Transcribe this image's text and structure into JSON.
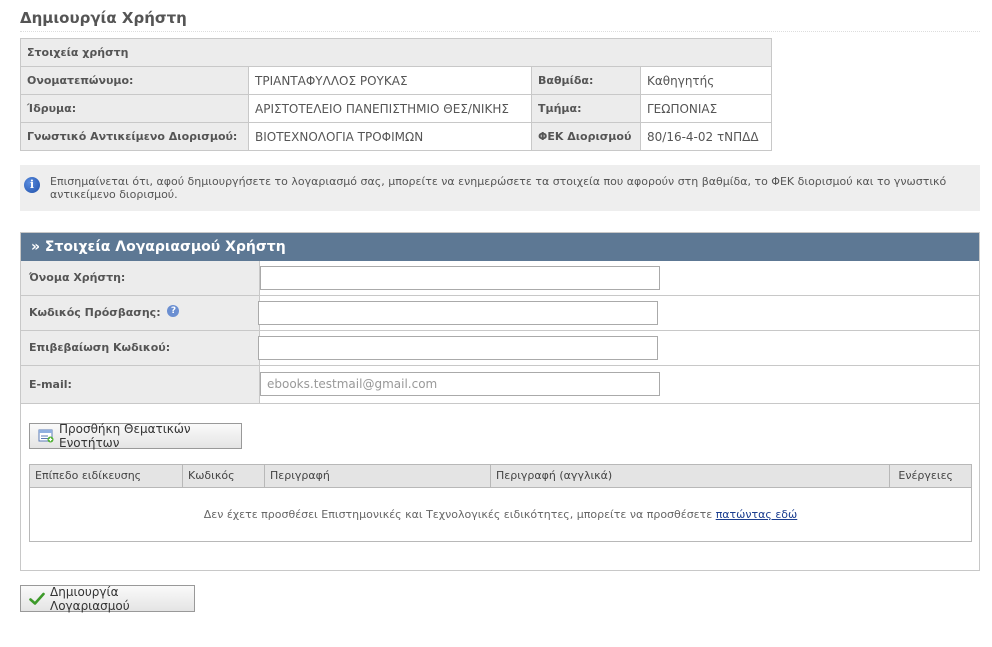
{
  "page": {
    "title": "Δημιουργία Χρήστη"
  },
  "user_info": {
    "heading": "Στοιχεία χρήστη",
    "rows": [
      {
        "label": "Ονοματεπώνυμο:",
        "value": "ΤΡΙΑΝΤΑΦΥΛΛΟΣ ΡΟΥΚΑΣ",
        "label2": "Βαθμίδα:",
        "value2": "Καθηγητής"
      },
      {
        "label": "Ίδρυμα:",
        "value": "ΑΡΙΣΤΟΤΕΛΕΙΟ ΠΑΝΕΠΙΣΤΗΜΙΟ ΘΕΣ/ΝΙΚΗΣ",
        "label2": "Τμήμα:",
        "value2": "ΓΕΩΠΟΝΙΑΣ"
      },
      {
        "label": "Γνωστικό Αντικείμενο Διορισμού:",
        "value": "ΒΙΟΤΕΧΝΟΛΟΓΙΑ ΤΡΟΦΙΜΩΝ",
        "label2": "ΦΕΚ Διορισμού",
        "value2": "80/16-4-02 τΝΠΔΔ"
      }
    ]
  },
  "notice": {
    "icon": "info-icon",
    "text": "Επισημαίνεται ότι, αφού δημιουργήσετε το λογαριασμό σας, μπορείτε να ενημερώσετε τα στοιχεία που αφορούν στη βαθμίδα, το ΦΕΚ διορισμού και το γνωστικό αντικείμενο διορισμού."
  },
  "account": {
    "header": "» Στοιχεία Λογαριασμού Χρήστη",
    "username_label": "Όνομα Χρήστη:",
    "username_value": "",
    "password_label": "Κωδικός Πρόσβασης:",
    "password_value": "",
    "confirm_label": "Επιβεβαίωση Κωδικού:",
    "confirm_value": "",
    "email_label": "E-mail:",
    "email_placeholder": "ebooks.testmail@gmail.com",
    "help_icon": "question-icon"
  },
  "subjects": {
    "add_button": "Προσθήκη Θεματικών Ενοτήτων",
    "columns": [
      "Επίπεδο ειδίκευσης",
      "Κωδικός",
      "Περιγραφή",
      "Περιγραφή (αγγλικά)",
      "Ενέργειες"
    ],
    "empty_text": "Δεν έχετε προσθέσει Επιστημονικές και Τεχνολογικές ειδικότητες, μπορείτε να προσθέσετε",
    "empty_link": "πατώντας εδώ"
  },
  "submit_button": "Δημιουργία Λογαριασμού",
  "colors": {
    "header_bg": "#5d7894",
    "label_bg": "#ececec",
    "link": "#1a3d8f"
  }
}
